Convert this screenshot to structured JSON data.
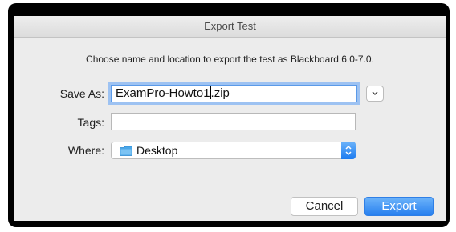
{
  "dialog": {
    "title": "Export Test",
    "message": "Choose name and location to export the test as Blackboard 6.0-7.0."
  },
  "save_as": {
    "label": "Save As:",
    "value_before_caret": "ExamPro-Howto1",
    "value_after_caret": ".zip"
  },
  "tags": {
    "label": "Tags:",
    "value": ""
  },
  "where": {
    "label": "Where:",
    "value": "Desktop",
    "icon": "folder-icon"
  },
  "buttons": {
    "cancel": "Cancel",
    "export": "Export"
  },
  "colors": {
    "accent": "#2880ef",
    "focus_ring": "#9dc2f2",
    "folder": "#4aa7e8"
  }
}
